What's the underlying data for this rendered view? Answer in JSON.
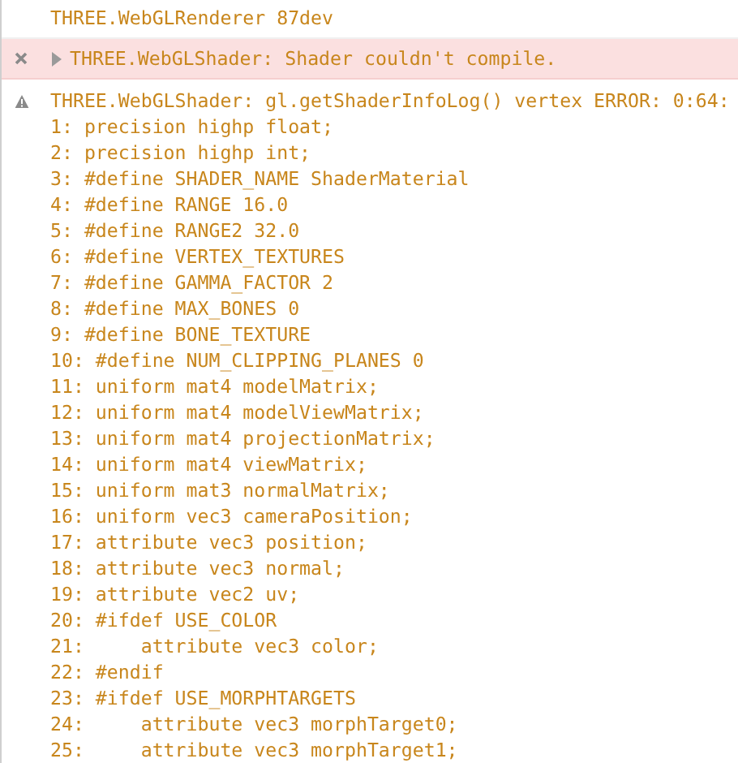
{
  "messages": [
    {
      "kind": "log",
      "text": "THREE.WebGLRenderer 87dev"
    },
    {
      "kind": "error",
      "text": "THREE.WebGLShader: Shader couldn't compile.",
      "expanded": false
    },
    {
      "kind": "warning",
      "text": "THREE.WebGLShader: gl.getShaderInfoLog() vertex ERROR: 0:64:",
      "lines": [
        "1: precision highp float;",
        "2: precision highp int;",
        "3: #define SHADER_NAME ShaderMaterial",
        "4: #define RANGE 16.0",
        "5: #define RANGE2 32.0",
        "6: #define VERTEX_TEXTURES",
        "7: #define GAMMA_FACTOR 2",
        "8: #define MAX_BONES 0",
        "9: #define BONE_TEXTURE",
        "10: #define NUM_CLIPPING_PLANES 0",
        "11: uniform mat4 modelMatrix;",
        "12: uniform mat4 modelViewMatrix;",
        "13: uniform mat4 projectionMatrix;",
        "14: uniform mat4 viewMatrix;",
        "15: uniform mat3 normalMatrix;",
        "16: uniform vec3 cameraPosition;",
        "17: attribute vec3 position;",
        "18: attribute vec3 normal;",
        "19: attribute vec2 uv;",
        "20: #ifdef USE_COLOR",
        "21:     attribute vec3 color;",
        "22: #endif",
        "23: #ifdef USE_MORPHTARGETS",
        "24:     attribute vec3 morphTarget0;",
        "25:     attribute vec3 morphTarget1;"
      ]
    }
  ]
}
